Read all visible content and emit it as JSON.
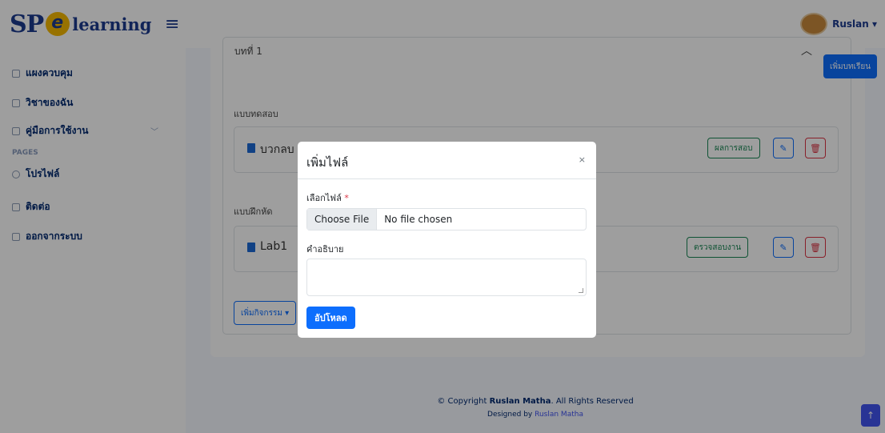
{
  "header": {
    "logo_sp": "SP",
    "logo_word": "learning",
    "user_name": "Ruslan ▾"
  },
  "sidebar": {
    "items": [
      {
        "label": "แผงควบคุม"
      },
      {
        "label": "วิชาของฉัน"
      },
      {
        "label": "คู่มือการใช้งาน"
      },
      {
        "label": "โปรไฟล์"
      },
      {
        "label": "ติดต่อ"
      },
      {
        "label": "ออกจากระบบ"
      }
    ],
    "pages_heading": "PAGES"
  },
  "content": {
    "lesson_title": "บทที่ 1",
    "add_lesson_label": "เพิ่มบทเรียน",
    "quiz_section": "แบบทดสอบ",
    "quiz_row_title": "บวกลบ",
    "quiz_results_label": "ผลการสอบ",
    "exercise_section": "แบบฝึกหัด",
    "exercise_row_title": "Lab1",
    "check_work_label": "ตรวจสอบงาน",
    "add_activity_label": "เพิ่มกิจกรรม ▾"
  },
  "footer": {
    "copyright_prefix": "© Copyright ",
    "copyright_name": "Ruslan Matha",
    "copyright_suffix": ". All Rights Reserved",
    "designed_prefix": "Designed by ",
    "designed_name": "Ruslan Matha"
  },
  "modal": {
    "title": "เพิ่มไฟล์",
    "close": "×",
    "file_label": "เลือกไฟล์",
    "required_mark": "*",
    "choose_file": "Choose File",
    "no_file": "No file chosen",
    "description_label": "คำอธิบาย",
    "upload_label": "อัปโหลด"
  },
  "colors": {
    "primary": "#0d6efd",
    "success": "#198754",
    "danger": "#dc3545",
    "brand": "#012970"
  }
}
